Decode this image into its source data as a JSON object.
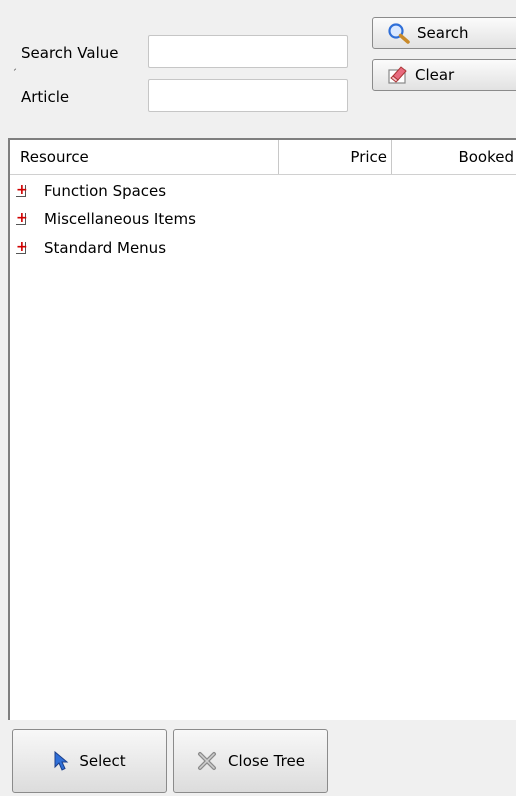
{
  "search": {
    "search_value_label": "Search Value",
    "search_value": "",
    "article_label": "Article",
    "article_value": "",
    "search_button": "Search",
    "clear_button": "Clear"
  },
  "table": {
    "columns": [
      "Resource",
      "Price",
      "Booked"
    ],
    "rows": [
      {
        "label": "Function Spaces",
        "expander": "+"
      },
      {
        "label": "Miscellaneous Items",
        "expander": "+"
      },
      {
        "label": "Standard Menus",
        "expander": "+"
      }
    ]
  },
  "footer": {
    "select_button": "Select",
    "close_tree_button": "Close Tree"
  },
  "icons": {
    "search": "magnifier-icon",
    "clear": "eraser-icon",
    "select": "cursor-arrow-icon",
    "close_tree": "close-tree-icon"
  },
  "colors": {
    "expander_plus": "#d00000",
    "search_icon": "#2f6fd8"
  }
}
